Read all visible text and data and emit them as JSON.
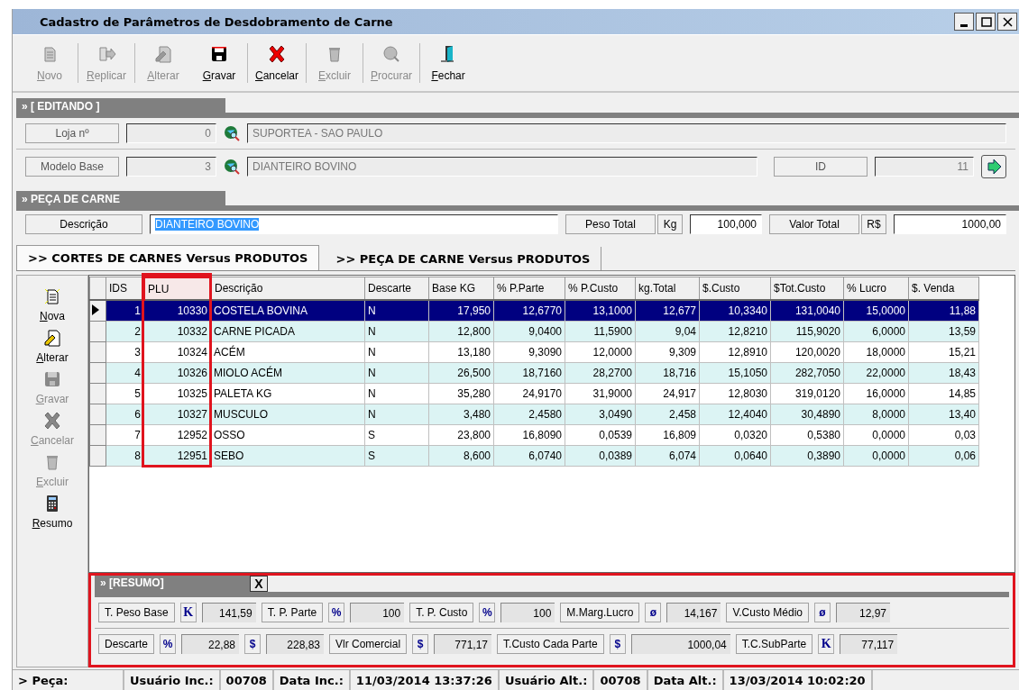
{
  "window": {
    "title": "Cadastro de Parâmetros de Desdobramento de Carne"
  },
  "toolbar": [
    {
      "label": "Novo",
      "kind": "new",
      "disabled": true
    },
    {
      "label": "Replicar",
      "kind": "replicate",
      "disabled": true
    },
    {
      "label": "Alterar",
      "kind": "edit",
      "disabled": true
    },
    {
      "label": "Gravar",
      "kind": "save",
      "disabled": false
    },
    {
      "label": "Cancelar",
      "kind": "cancel",
      "disabled": false
    },
    {
      "label": "Excluir",
      "kind": "delete",
      "disabled": true
    },
    {
      "label": "Procurar",
      "kind": "search",
      "disabled": true
    },
    {
      "label": "Fechar",
      "kind": "exit",
      "disabled": false
    }
  ],
  "editing": {
    "title": "» [ EDITANDO ]",
    "store": {
      "label": "Loja nº",
      "code": "0",
      "name": "SUPORTEA - SAO PAULO"
    },
    "model": {
      "label": "Modelo Base",
      "code": "3",
      "name": "DIANTEIRO BOVINO",
      "id_label": "ID",
      "id": "11"
    }
  },
  "piece": {
    "title": "» PEÇA DE CARNE",
    "description_label": "Descrição",
    "description": "DIANTEIRO BOVINO",
    "description_selected": true,
    "weight_label": "Peso Total",
    "weight_unit": "Kg",
    "weight": "100,000",
    "value_label": "Valor Total",
    "value_unit": "R$",
    "value": "1000,00"
  },
  "tabs": [
    {
      "label": ">> CORTES DE CARNES Versus PRODUTOS",
      "selected": true
    },
    {
      "label": ">> PEÇA DE CARNE Versus PRODUTOS",
      "selected": false
    }
  ],
  "side_actions": [
    {
      "label": "Nova",
      "kind": "new",
      "disabled": false
    },
    {
      "label": "Alterar",
      "kind": "edit",
      "disabled": false
    },
    {
      "label": "Gravar",
      "kind": "save",
      "disabled": true
    },
    {
      "label": "Cancelar",
      "kind": "cancel",
      "disabled": true
    },
    {
      "label": "Excluir",
      "kind": "delete",
      "disabled": true
    },
    {
      "label": "Resumo",
      "kind": "calculator",
      "disabled": false
    }
  ],
  "table": {
    "columns": [
      {
        "label": "IDS",
        "highlighted": false
      },
      {
        "label": "PLU",
        "highlighted": true
      },
      {
        "label": "Descrição",
        "highlighted": false
      },
      {
        "label": "Descarte",
        "highlighted": false
      },
      {
        "label": "Base KG",
        "highlighted": false
      },
      {
        "label": "% P.Parte",
        "highlighted": false
      },
      {
        "label": "% P.Custo",
        "highlighted": false
      },
      {
        "label": "kg.Total",
        "highlighted": false
      },
      {
        "label": "$.Custo",
        "highlighted": false
      },
      {
        "label": "$Tot.Custo",
        "highlighted": false
      },
      {
        "label": "% Lucro",
        "highlighted": false
      },
      {
        "label": "$. Venda",
        "highlighted": false
      }
    ],
    "rows": [
      {
        "selected": true,
        "cells": [
          "1",
          "10330",
          "COSTELA BOVINA",
          "N",
          "17,950",
          "12,6770",
          "13,1000",
          "12,677",
          "10,3340",
          "131,0040",
          "15,0000",
          "11,88"
        ]
      },
      {
        "selected": false,
        "cells": [
          "2",
          "10332",
          "CARNE PICADA",
          "N",
          "12,800",
          "9,0400",
          "11,5900",
          "9,04",
          "12,8210",
          "115,9020",
          "6,0000",
          "13,59"
        ]
      },
      {
        "selected": false,
        "cells": [
          "3",
          "10324",
          "ACÉM",
          "N",
          "13,180",
          "9,3090",
          "12,0000",
          "9,309",
          "12,8910",
          "120,0020",
          "18,0000",
          "15,21"
        ]
      },
      {
        "selected": false,
        "cells": [
          "4",
          "10326",
          "MIOLO ACÉM",
          "N",
          "26,500",
          "18,7160",
          "28,2700",
          "18,716",
          "15,1050",
          "282,7050",
          "22,0000",
          "18,43"
        ]
      },
      {
        "selected": false,
        "cells": [
          "5",
          "10325",
          "PALETA KG",
          "N",
          "35,280",
          "24,9170",
          "31,9000",
          "24,917",
          "12,8030",
          "319,0120",
          "16,0000",
          "14,85"
        ]
      },
      {
        "selected": false,
        "cells": [
          "6",
          "10327",
          "MUSCULO",
          "N",
          "3,480",
          "2,4580",
          "3,0490",
          "2,458",
          "12,4040",
          "30,4890",
          "8,0000",
          "13,40"
        ]
      },
      {
        "selected": false,
        "cells": [
          "7",
          "12952",
          "OSSO",
          "S",
          "23,800",
          "16,8090",
          "0,0539",
          "16,809",
          "0,0320",
          "0,5380",
          "0,0000",
          "0,03"
        ]
      },
      {
        "selected": false,
        "cells": [
          "8",
          "12951",
          "SEBO",
          "S",
          "8,600",
          "6,0740",
          "0,0389",
          "6,074",
          "0,0640",
          "0,3890",
          "0,0000",
          "0,06"
        ]
      }
    ]
  },
  "summary": {
    "title": "» [RESUMO]",
    "close": "X",
    "highlighted": true,
    "lines": [
      {
        "fields": [
          {
            "label": "T. Peso Base",
            "values": [
              {
                "unit": "K",
                "value": "141,59"
              }
            ]
          },
          {
            "label": "T. P. Parte",
            "values": [
              {
                "unit": "%",
                "value": "100"
              }
            ]
          },
          {
            "label": "T. P. Custo",
            "values": [
              {
                "unit": "%",
                "value": "100"
              }
            ]
          },
          {
            "label": "M.Marg.Lucro",
            "values": [
              {
                "unit": "ø",
                "value": "14,167"
              }
            ]
          },
          {
            "label": "V.Custo Médio",
            "values": [
              {
                "unit": "ø",
                "value": "12,97"
              }
            ]
          }
        ]
      },
      {
        "fields": [
          {
            "label": "Descarte",
            "values": [
              {
                "unit": "%",
                "value": "22,88"
              },
              {
                "unit": "$",
                "value": "228,83"
              }
            ]
          },
          {
            "label": "Vlr Comercial",
            "values": [
              {
                "unit": "$",
                "value": "771,17"
              }
            ]
          },
          {
            "label": "T.Custo Cada Parte",
            "values": [
              {
                "unit": "$",
                "value": "1000,04"
              }
            ]
          },
          {
            "label": "T.C.SubParte",
            "values": [
              {
                "unit": "K",
                "value": "77,117"
              }
            ]
          }
        ]
      }
    ]
  },
  "status_bar": {
    "piece_label": "> Peça:",
    "items": [
      {
        "label": "Usuário Inc.:",
        "value": "00708"
      },
      {
        "label": "Data Inc.:",
        "value": "11/03/2014 13:37:26"
      },
      {
        "label": "Usuário Alt.:",
        "value": "00708"
      },
      {
        "label": "Data Alt.:",
        "value": "13/03/2014 10:02:20"
      }
    ]
  }
}
